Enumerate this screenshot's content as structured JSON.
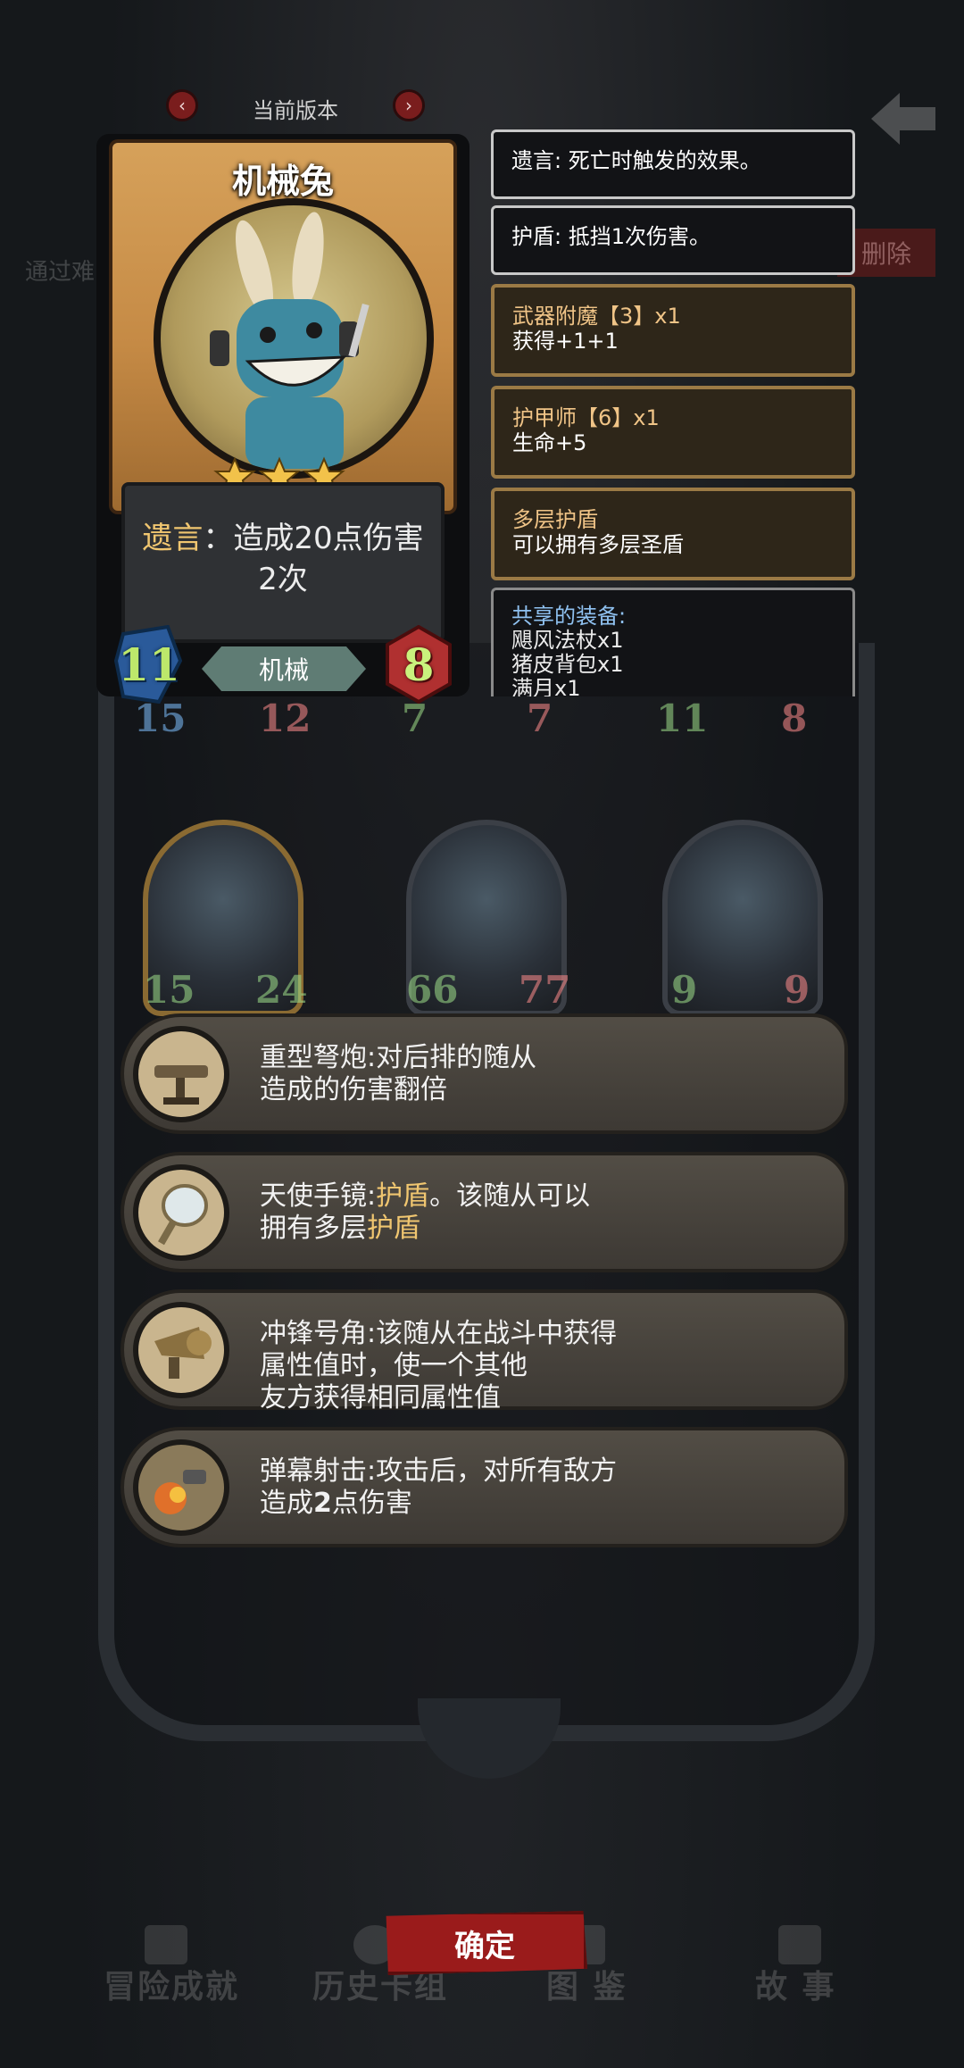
{
  "version_switch": {
    "label": "当前版本",
    "prev_icon": "chevron-left-icon",
    "next_icon": "chevron-right-icon"
  },
  "background": {
    "left_text": "通过难",
    "delete_label": "删除"
  },
  "card": {
    "name": "机械兔",
    "stars": 3,
    "text_keyword": "遗言",
    "text_sep": "：",
    "text_line1": "造成20点伤害",
    "text_line2": "2次",
    "attack": "11",
    "health": "8",
    "tribe": "机械"
  },
  "info_panels": [
    {
      "desc": "遗言: 死亡时触发的效果。"
    },
    {
      "desc": "护盾: 抵挡1次伤害。"
    },
    {
      "title": "武器附魔【3】x1",
      "desc": "获得+1+1"
    },
    {
      "title": "护甲师【6】x1",
      "desc": "生命+5"
    },
    {
      "title": "多层护盾",
      "desc": "可以拥有多层圣盾"
    }
  ],
  "shared_equipment": {
    "title": "共享的装备:",
    "items": [
      "飓风法杖x1",
      "猪皮背包x1",
      "满月x1"
    ]
  },
  "board_tokens_row1": [
    {
      "attack": "15",
      "health": "12"
    },
    {
      "attack": "7",
      "health": "7"
    },
    {
      "attack": "11",
      "health": "8"
    }
  ],
  "board_tokens_row2": [
    {
      "attack": "15",
      "health": "24"
    },
    {
      "attack": "66",
      "health": "77"
    },
    {
      "attack": "9",
      "health": "9"
    }
  ],
  "relics": [
    {
      "icon": "crossbow-icon",
      "line1": "重型弩炮:对后排的随从",
      "line2": "造成的伤害翻倍"
    },
    {
      "icon": "mirror-icon",
      "line1_a": "天使手镜:",
      "line1_b": "护盾",
      "line1_c": "。该随从可以",
      "line2_a": "拥有多层",
      "line2_b": "护盾"
    },
    {
      "icon": "horn-icon",
      "line1": "冲锋号角:该随从在战斗中获得",
      "line2": "属性值时，使一个其他",
      "line3": "友方获得相同属性值"
    },
    {
      "icon": "barrage-icon",
      "line1": "弹幕射击:攻击后，对所有敌方",
      "line2_a": "造成",
      "line2_b": "2",
      "line2_c": "点伤害"
    }
  ],
  "confirm_label": "确定",
  "bottom_nav": [
    {
      "label": "冒险成就",
      "icon": "trophy-icon"
    },
    {
      "label": "历史卡组",
      "icon": "history-icon"
    },
    {
      "label": "图 鉴",
      "icon": "book-icon"
    },
    {
      "label": "故 事",
      "icon": "story-icon"
    }
  ],
  "colors": {
    "gold_keyword": "#f0c670",
    "confirm": "#9a1b1b",
    "shared_title": "#8fc1f0"
  }
}
